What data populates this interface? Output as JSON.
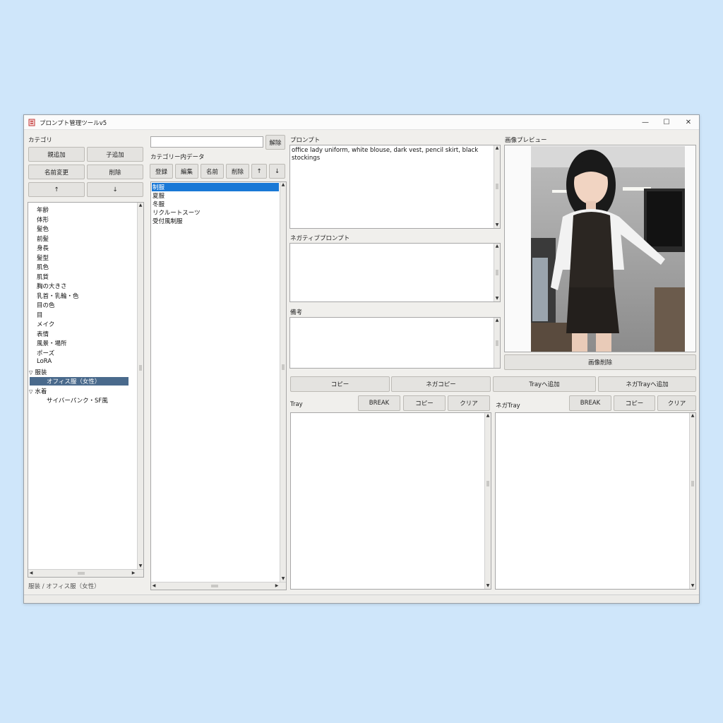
{
  "window": {
    "title": "プロンプト管理ツールv5"
  },
  "category": {
    "label": "カテゴリ",
    "buttons": {
      "add_parent": "親追加",
      "add_child": "子追加",
      "rename": "名前変更",
      "delete": "削除",
      "up": "↑",
      "down": "↓"
    },
    "tree": [
      {
        "label": "年齢",
        "level": 0
      },
      {
        "label": "体形",
        "level": 0
      },
      {
        "label": "髪色",
        "level": 0
      },
      {
        "label": "前髪",
        "level": 0
      },
      {
        "label": "身長",
        "level": 0
      },
      {
        "label": "髪型",
        "level": 0
      },
      {
        "label": "肌色",
        "level": 0
      },
      {
        "label": "肌質",
        "level": 0
      },
      {
        "label": "胸の大きさ",
        "level": 0
      },
      {
        "label": "乳首・乳輪・色",
        "level": 0
      },
      {
        "label": "目の色",
        "level": 0
      },
      {
        "label": "目",
        "level": 0
      },
      {
        "label": "メイク",
        "level": 0
      },
      {
        "label": "表情",
        "level": 0
      },
      {
        "label": "風景・場所",
        "level": 0
      },
      {
        "label": "ポーズ",
        "level": 0
      },
      {
        "label": "LoRA",
        "level": 0
      },
      {
        "label": "服装",
        "level": 0,
        "expanded": true
      },
      {
        "label": "オフィス服（女性）",
        "level": 1,
        "selected": true
      },
      {
        "label": "水着",
        "level": 0,
        "expanded": true
      },
      {
        "label": "サイバーパンク・SF風",
        "level": 1
      }
    ],
    "path": "服装 / オフィス服（女性）"
  },
  "data_panel": {
    "search_value": "",
    "clear_label": "解除",
    "label": "カテゴリー内データ",
    "buttons": {
      "register": "登録",
      "edit": "編集",
      "name": "名前",
      "delete": "削除",
      "up": "↑",
      "down": "↓"
    },
    "items": [
      {
        "label": "制服",
        "selected": true
      },
      {
        "label": "夏服"
      },
      {
        "label": "冬服"
      },
      {
        "label": "リクルートスーツ"
      },
      {
        "label": "受付風制服"
      }
    ]
  },
  "prompt": {
    "label": "プロンプト",
    "value": "office lady uniform, white blouse, dark vest, pencil skirt, black stockings",
    "negative_label": "ネガティブプロンプト",
    "negative_value": "",
    "notes_label": "備考",
    "notes_value": ""
  },
  "actions": {
    "copy": "コピー",
    "nega_copy": "ネガコピー",
    "add_tray": "Trayへ追加",
    "add_nega_tray": "ネガTrayへ追加"
  },
  "tray": {
    "label": "Tray",
    "break": "BREAK",
    "copy": "コピー",
    "clear": "クリア"
  },
  "nega_tray": {
    "label": "ネガTray",
    "break": "BREAK",
    "copy": "コピー",
    "clear": "クリア"
  },
  "preview": {
    "label": "画像プレビュー",
    "delete_label": "画像削除"
  },
  "icons": {
    "up_arrow": "▲",
    "down_arrow": "▼",
    "left_arrow": "◀",
    "right_arrow": "▶",
    "minimize": "—",
    "maximize": "☐",
    "close": "✕",
    "expand": "▽"
  }
}
